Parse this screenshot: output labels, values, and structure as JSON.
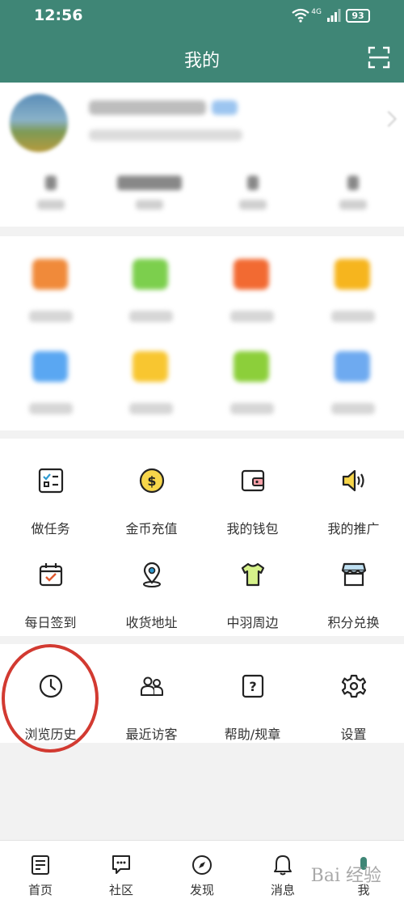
{
  "status_bar": {
    "time": "12:56",
    "signal": "4G",
    "battery": "93"
  },
  "header": {
    "title": "我的",
    "scan_icon": "scan-icon",
    "bg_color": "#3f8676"
  },
  "services": [
    {
      "label": "做任务",
      "icon": "task-list-icon"
    },
    {
      "label": "金币充值",
      "icon": "coin-icon"
    },
    {
      "label": "我的钱包",
      "icon": "wallet-icon"
    },
    {
      "label": "我的推广",
      "icon": "speaker-icon"
    },
    {
      "label": "每日签到",
      "icon": "calendar-check-icon"
    },
    {
      "label": "收货地址",
      "icon": "location-pin-icon"
    },
    {
      "label": "中羽周边",
      "icon": "tshirt-icon"
    },
    {
      "label": "积分兑换",
      "icon": "store-icon"
    }
  ],
  "tools": [
    {
      "label": "浏览历史",
      "icon": "clock-icon"
    },
    {
      "label": "最近访客",
      "icon": "visitors-icon"
    },
    {
      "label": "帮助/规章",
      "icon": "help-icon"
    },
    {
      "label": "设置",
      "icon": "gear-icon"
    }
  ],
  "tabbar": [
    {
      "label": "首页",
      "icon": "home-doc-icon"
    },
    {
      "label": "社区",
      "icon": "community-chat-icon"
    },
    {
      "label": "发现",
      "icon": "compass-icon"
    },
    {
      "label": "消息",
      "icon": "bell-icon"
    },
    {
      "label": "我",
      "icon": "profile-icon"
    }
  ],
  "watermark": "Bai 经验",
  "highlight_color": "#d23a31"
}
